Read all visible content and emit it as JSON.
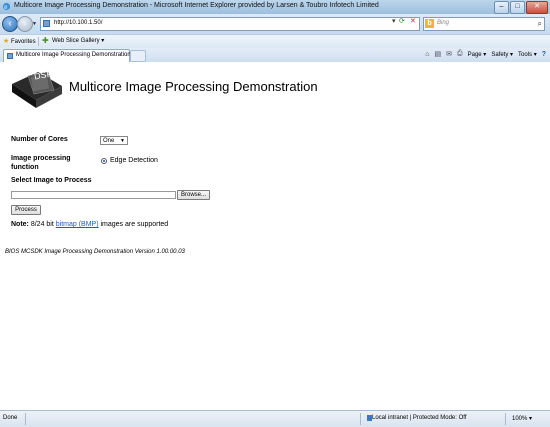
{
  "window": {
    "title": "Multicore Image Processing Demonstration - Microsoft Internet Explorer provided by Larsen & Toubro Infotech Limited",
    "minimize": "–",
    "maximize": "□",
    "close": "✕"
  },
  "address": {
    "url": "http://10.100.1.50/"
  },
  "search": {
    "placeholder": "Bing",
    "engine": "b"
  },
  "favorites": {
    "label": "Favorites",
    "web_slice": "Web Slice Gallery ▾"
  },
  "tab": {
    "label": "Multicore Image Processing Demonstration"
  },
  "commands": {
    "page": "Page ▾",
    "safety": "Safety ▾",
    "tools": "Tools ▾",
    "help": "?"
  },
  "page": {
    "logo_text": "DSP",
    "title": "Multicore Image Processing Demonstration",
    "cores_label": "Number of Cores",
    "cores_value": "One",
    "function_label": "Image processing function",
    "function_option": "Edge Detection",
    "select_image_label": "Select Image to Process",
    "browse_label": "Browse...",
    "process_label": "Process",
    "note_bold": "Note:",
    "note_pre": " 8/24 bit ",
    "note_link": "bitmap (BMP)",
    "note_post": " images are supported",
    "version": "BIOS MCSDK Image Processing Demonstration Version 1.00.00.03"
  },
  "status": {
    "done": "Done",
    "zone": "Local intranet | Protected Mode: Off",
    "zoom": "100% ▾"
  }
}
